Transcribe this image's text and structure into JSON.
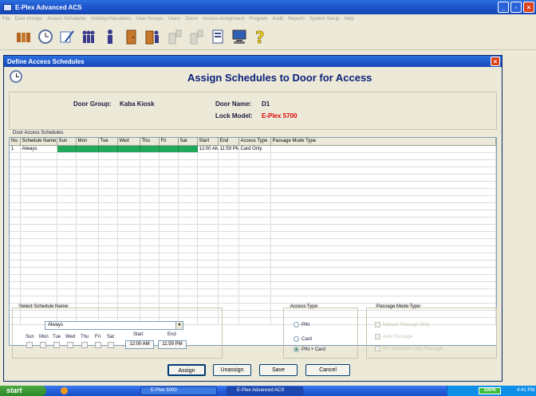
{
  "app": {
    "title": "E-Plex Advanced ACS",
    "menu": [
      "File",
      "Door Groups",
      "Access Schedules",
      "Holidays/Vacations",
      "User Groups",
      "Users",
      "Doors",
      "Access Assignment",
      "Program",
      "Audit",
      "Reports",
      "System Setup",
      "Help"
    ],
    "toolbar_icons": [
      "doors-icon",
      "clock-icon",
      "schedule-pen-icon",
      "user-group-icon",
      "single-user-icon",
      "door-icon",
      "door-assign-icon",
      "program-lock-icon",
      "audit-lock-icon",
      "report-icon",
      "computer-icon",
      "help-icon"
    ]
  },
  "dialog": {
    "title": "Define Access Schedules",
    "heading": "Assign Schedules to Door for Access",
    "door_group_label": "Door Group:",
    "door_group_value": "Kaba Kiosk",
    "door_name_label": "Door Name:",
    "door_name_value": "D1",
    "lock_model_label": "Lock Model:",
    "lock_model_value": "E-Plex 5700"
  },
  "schedules": {
    "legend": "Door Access Schedules",
    "columns": [
      "No.",
      "Schedule Name",
      "Sun",
      "Mon",
      "Tue",
      "Wed",
      "Thu",
      "Fri",
      "Sat",
      "Start",
      "End",
      "Access Type",
      "Passage Mode Type"
    ],
    "rows": [
      {
        "no": "1",
        "name": "Always",
        "start": "12:00 AM",
        "end": "11:59 PM",
        "access_type": "Card Only",
        "passage_mode": ""
      }
    ]
  },
  "select_schedule": {
    "legend": "Select Schedule Name",
    "selected": "Always",
    "days": [
      "Sun",
      "Mon",
      "Tue",
      "Wed",
      "Thu",
      "Fri",
      "Sat"
    ],
    "start_label": "Start",
    "start_value": "12:00 AM",
    "end_label": "End",
    "end_value": "11:59 PM"
  },
  "access_type": {
    "legend": "Access Type",
    "options": [
      "PIN",
      "Card",
      "PIN + Card"
    ],
    "selected": "PIN + Card"
  },
  "passage_mode": {
    "legend": "Passage Mode Type",
    "options": [
      "Manual Passage Only",
      "Auto Passage",
      "Pin Initialized Card Passage"
    ]
  },
  "buttons": {
    "assign": "Assign",
    "unassign": "Unassign",
    "save": "Save",
    "cancel": "Cancel"
  },
  "taskbar": {
    "start": "start",
    "tasks": [
      "E-Plex 5000",
      "E-Plex Advanced ACS"
    ],
    "zoom": "100%",
    "clock": "4:41 PM"
  },
  "colors": {
    "title_blue": "#1d56cc",
    "heading_navy": "#0a1f7a",
    "green_cell": "#22a85a",
    "red_value": "#e00000"
  }
}
